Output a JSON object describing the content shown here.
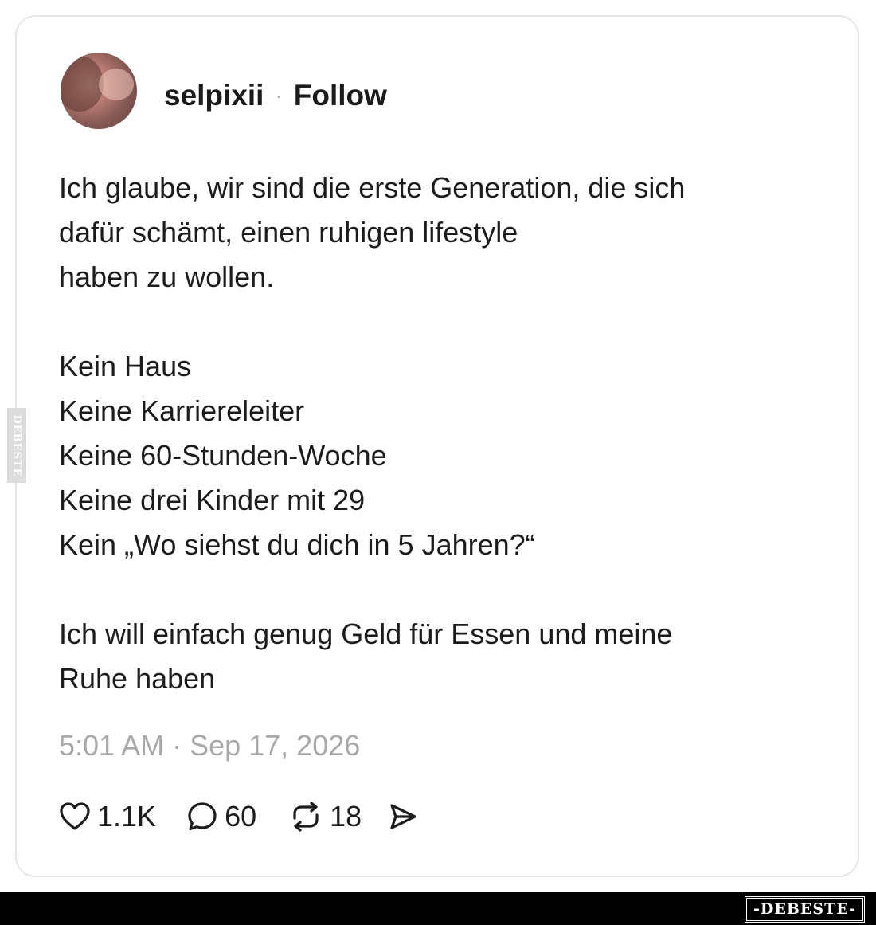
{
  "post": {
    "username": "selpixii",
    "separator": "·",
    "follow_label": "Follow",
    "text_lines": [
      "Ich glaube, wir sind die erste Generation, die sich",
      "dafür schämt, einen ruhigen lifestyle",
      "haben zu wollen.",
      "",
      "Kein Haus",
      "Keine Karriereleiter",
      "Keine 60-Stunden-Woche",
      "Keine drei Kinder mit 29",
      "Kein „Wo siehst du dich in 5 Jahren?“",
      "",
      "Ich will einfach genug Geld für Essen und meine",
      "Ruhe haben"
    ],
    "timestamp": "5:01 AM · Sep 17, 2026"
  },
  "actions": {
    "likes": "1.1K",
    "comments": "60",
    "reposts": "18",
    "icons": [
      "heart-icon",
      "comment-icon",
      "repost-icon",
      "share-icon"
    ]
  },
  "watermark": {
    "side_text": "DEBESTE",
    "brand_text": "-DEBESTE-"
  },
  "colors": {
    "text": "#1c1c1c",
    "muted": "#a9a9a9",
    "card_border": "#e6e6e6",
    "bar": "#000000"
  }
}
